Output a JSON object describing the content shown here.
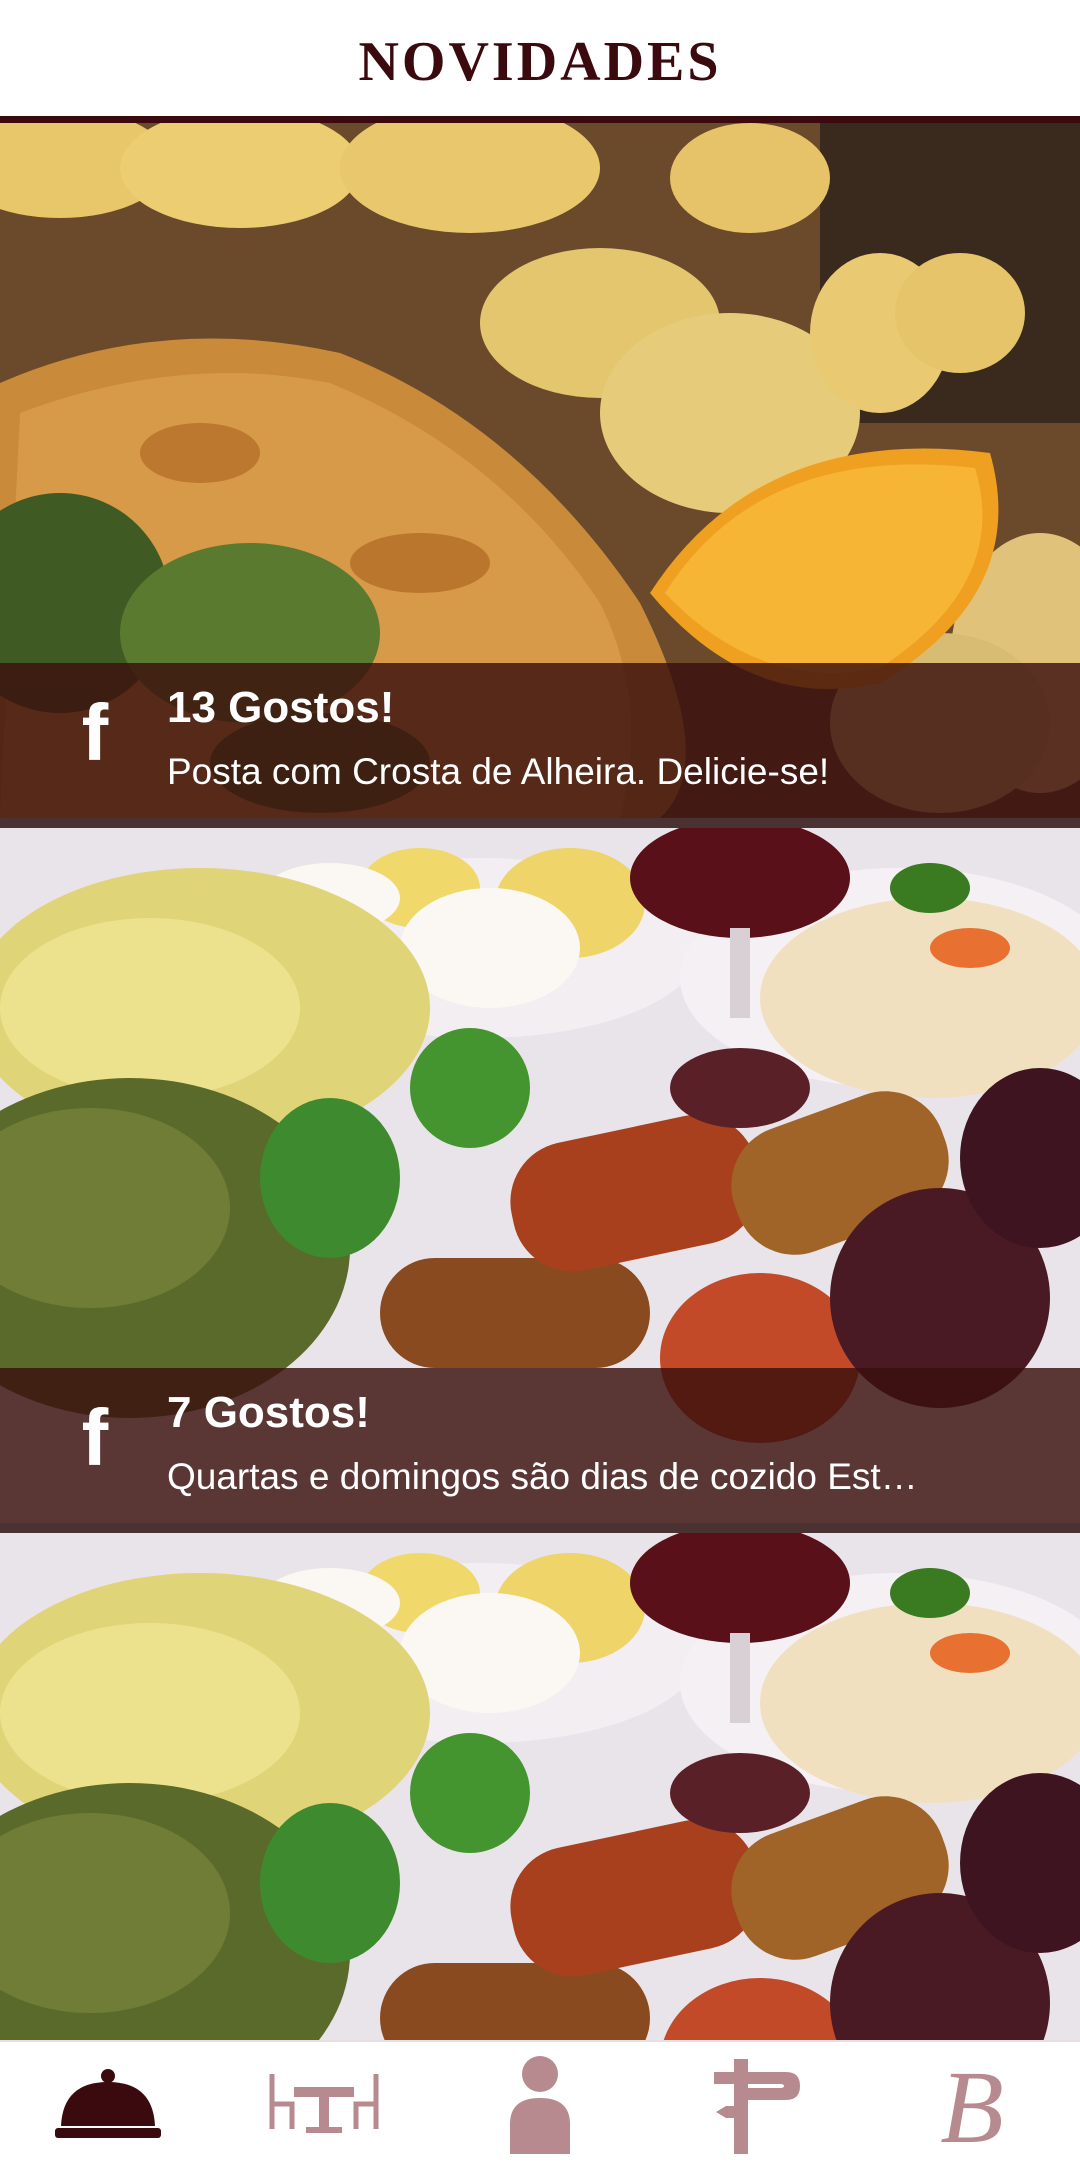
{
  "header": {
    "title": "NOVIDADES"
  },
  "posts": [
    {
      "image": "fish-with-alheira-crust-and-potatoes-photo",
      "icon": "facebook-icon",
      "likes": "13 Gostos!",
      "message": "Posta com Crosta de Alheira. Delicie-se!"
    },
    {
      "image": "cozido-stew-sausages-cabbage-photo",
      "icon": "facebook-icon",
      "likes": "7 Gostos!",
      "message": "Quartas e domingos são dias de cozido Est…"
    },
    {
      "image": "cozido-stew-sausages-cabbage-photo",
      "icon": "facebook-icon",
      "likes": "",
      "message": ""
    }
  ],
  "tabbar": {
    "items": [
      {
        "icon": "cloche-icon",
        "active": true
      },
      {
        "icon": "table-chairs-icon",
        "active": false
      },
      {
        "icon": "person-icon",
        "active": false
      },
      {
        "icon": "signpost-icon",
        "active": false
      },
      {
        "icon": "brand-b-icon",
        "active": false
      }
    ]
  },
  "colors": {
    "brand_dark": "#3a0a0e",
    "icon_inactive": "#b78a90",
    "caption_bg": "#3a100e"
  }
}
